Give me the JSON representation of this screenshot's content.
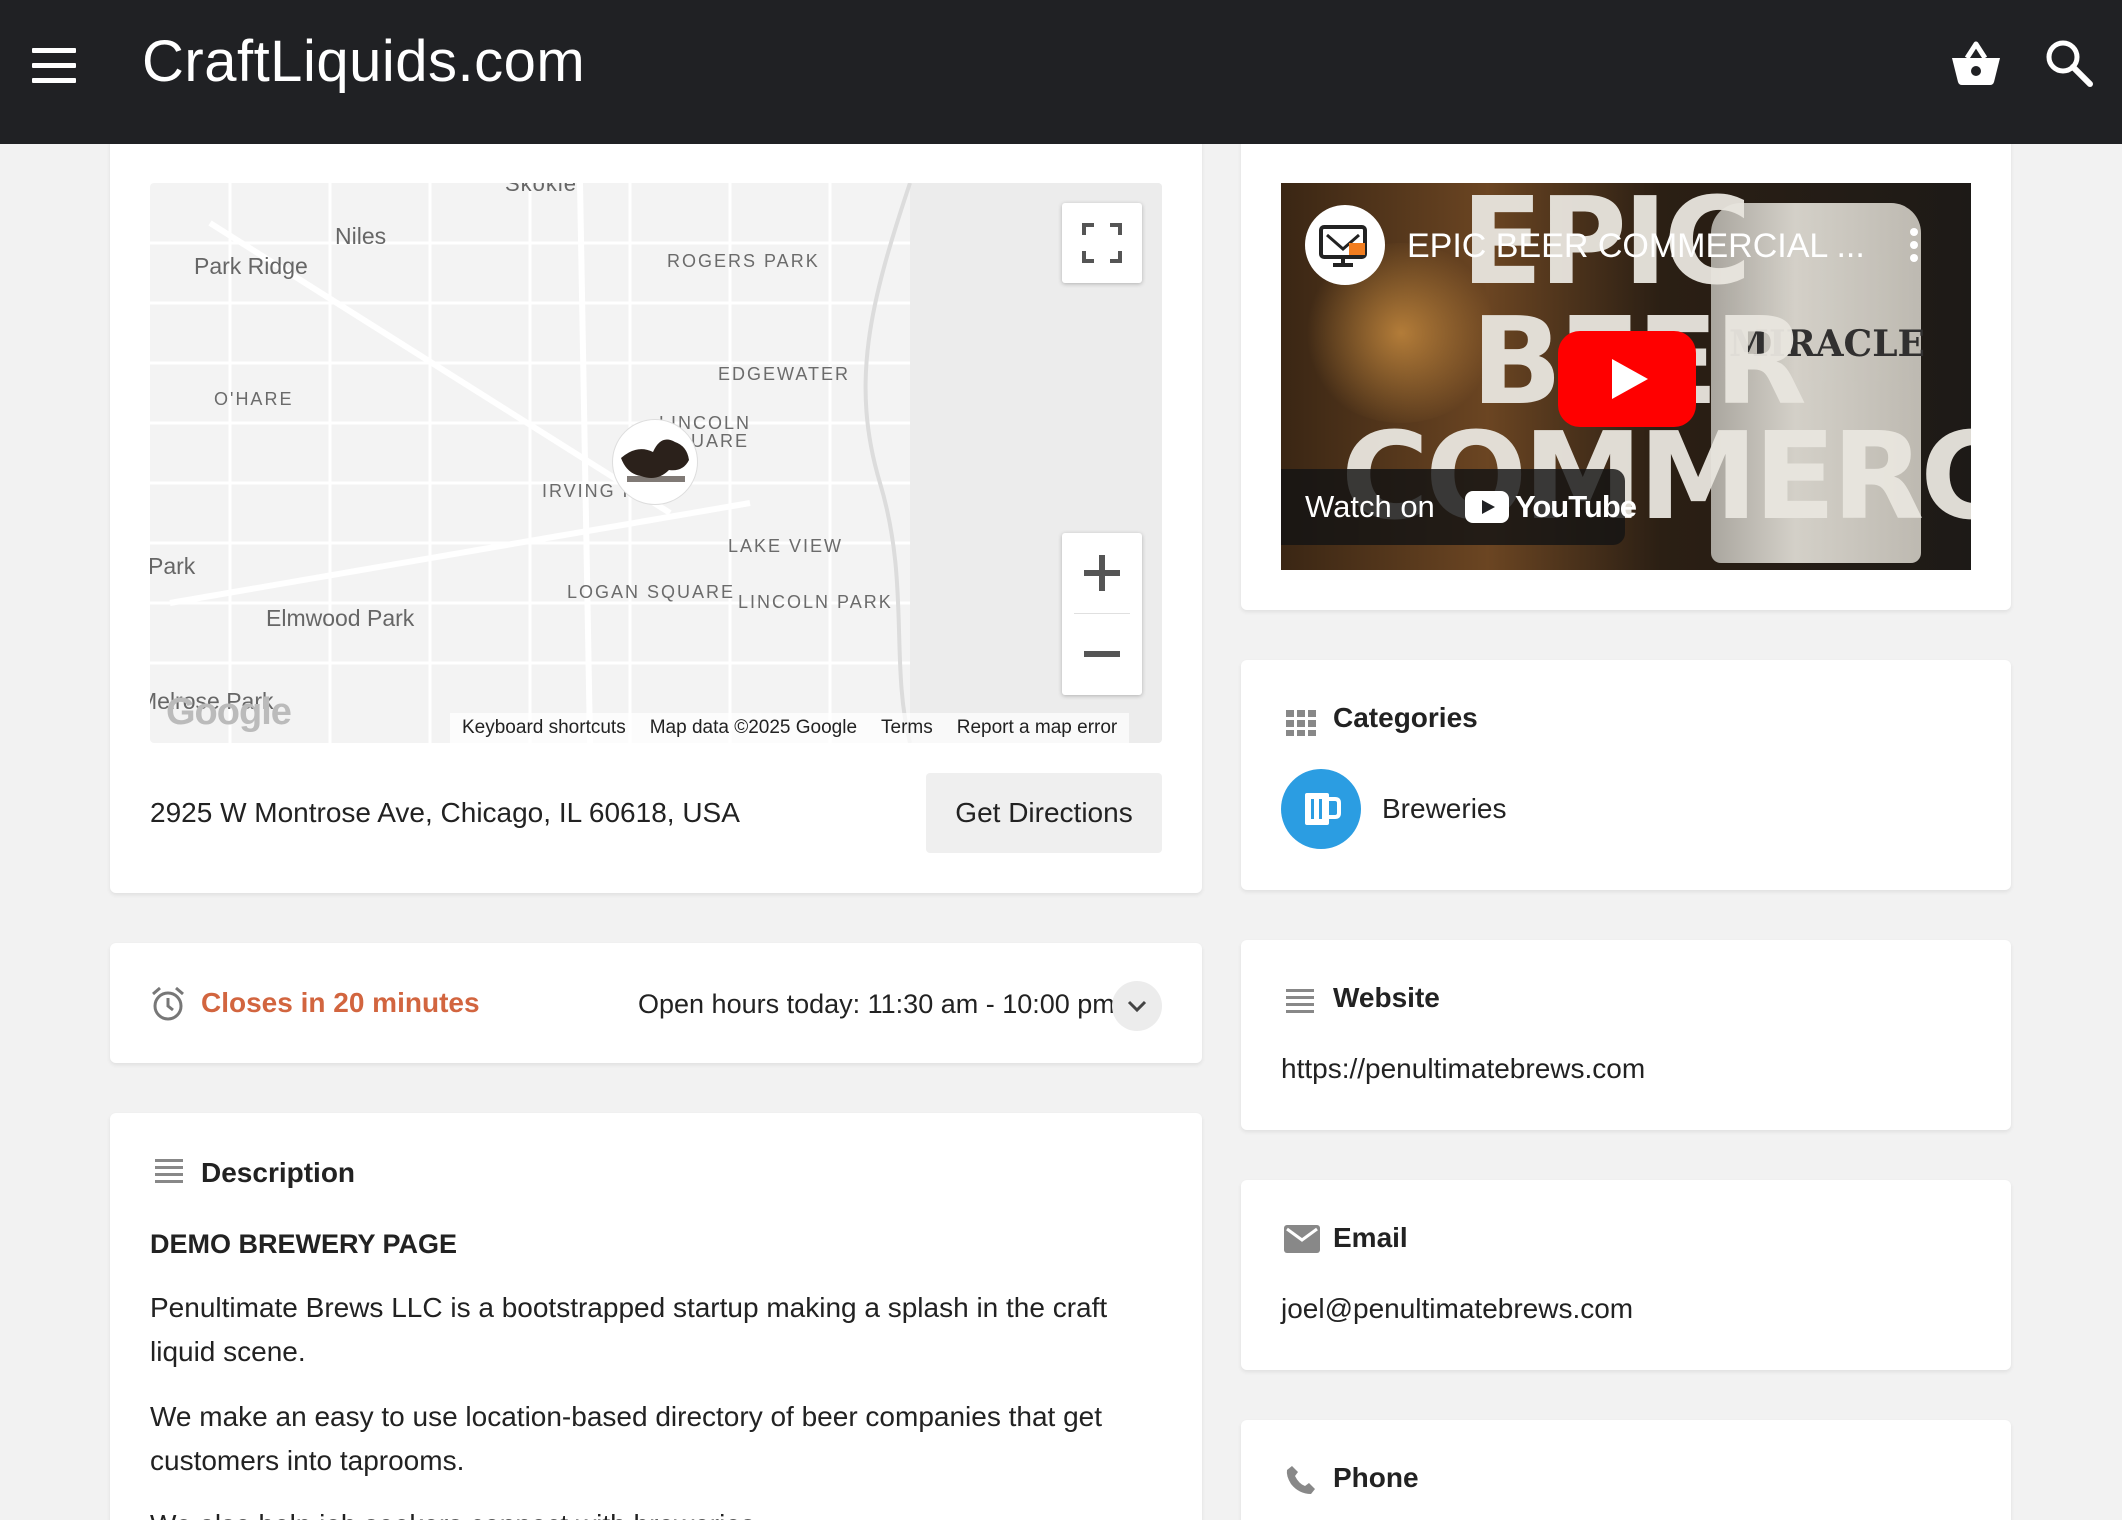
{
  "header": {
    "site_title": "CraftLiquids.com",
    "menu_icon": "menu-icon",
    "basket_icon": "basket-icon",
    "search_icon": "search-icon"
  },
  "map": {
    "labels": [
      "Skokie",
      "Niles",
      "Park Ridge",
      "ROGERS PARK",
      "EDGEWATER",
      "O'HARE",
      "LINCOLN SQUARE",
      "IRVING PARK",
      "LAKE VIEW",
      "Park",
      "LOGAN SQUARE",
      "LINCOLN PARK",
      "Elmwood Park",
      "Melrose Park"
    ],
    "logo": "Google",
    "attribution": {
      "keyboard": "Keyboard shortcuts",
      "data": "Map data ©2025 Google",
      "terms": "Terms",
      "report": "Report a map error"
    }
  },
  "location": {
    "address": "2925 W Montrose Ave, Chicago, IL 60618, USA",
    "directions_label": "Get Directions"
  },
  "hours": {
    "status": "Closes in 20 minutes",
    "today": "Open hours today: 11:30 am - 10:00 pm",
    "status_color": "#d2653f"
  },
  "description": {
    "title": "Description",
    "heading": "DEMO BREWERY PAGE",
    "paragraphs": [
      "Penultimate Brews LLC is a bootstrapped startup making a splash in the craft liquid scene.",
      "We make an easy to use location-based directory of beer companies that get customers into taprooms.",
      "We also help job seekers connect with breweries."
    ]
  },
  "video": {
    "title": "EPIC BEER COMMERCIAL ...",
    "overlay_line1": "EPIC",
    "overlay_line2": "BEER",
    "overlay_line3": "COMMERCIAL",
    "watch_on": "Watch on",
    "youtube": "YouTube",
    "bottle_text": "MIRACLE"
  },
  "categories": {
    "title": "Categories",
    "items": [
      {
        "label": "Breweries",
        "color": "#2b9de2"
      }
    ]
  },
  "website": {
    "title": "Website",
    "url": "https://penultimatebrews.com"
  },
  "email": {
    "title": "Email",
    "value": "joel@penultimatebrews.com"
  },
  "phone": {
    "title": "Phone"
  }
}
